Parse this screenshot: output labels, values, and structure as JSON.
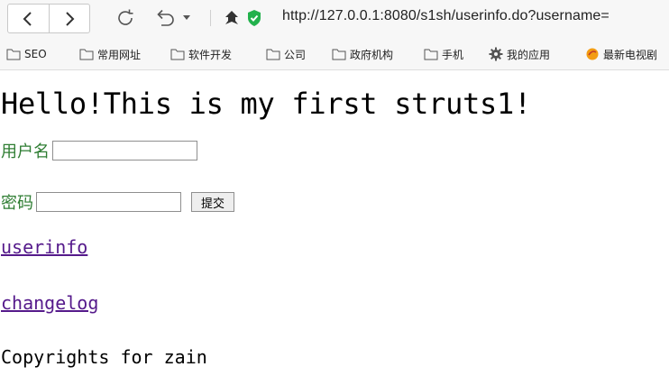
{
  "browser": {
    "url": "http://127.0.0.1:8080/s1sh/userinfo.do?username=",
    "icons": {
      "back": "chevron-left-icon",
      "forward": "chevron-right-icon",
      "refresh": "refresh-icon",
      "undo": "undo-icon",
      "undo_menu": "caret-down-icon",
      "security_a": "shield-icon",
      "security_b": "verified-shield-icon"
    },
    "colors": {
      "verified": "#22b14c",
      "folder_outline": "#555555"
    }
  },
  "bookmarks": [
    {
      "label": "SEO",
      "icon": "folder-icon"
    },
    {
      "label": "常用网址",
      "icon": "folder-icon"
    },
    {
      "label": "软件开发",
      "icon": "folder-icon"
    },
    {
      "label": "公司",
      "icon": "folder-icon"
    },
    {
      "label": "政府机构",
      "icon": "folder-icon"
    },
    {
      "label": "手机",
      "icon": "folder-icon"
    },
    {
      "label": "我的应用",
      "icon": "gear-icon"
    },
    {
      "label": "最新电视剧",
      "icon": "orange-circle-icon"
    }
  ],
  "page": {
    "headline": "Hello!This is my first struts1!",
    "form": {
      "username_label": "用户名",
      "username_value": "",
      "password_label": "密码",
      "password_value": "",
      "submit_label": "提交"
    },
    "links": {
      "userinfo": "userinfo",
      "changelog": "changelog"
    },
    "footer": "Copyrights for zain",
    "colors": {
      "label": "#2e7d32",
      "link_visited": "#551a8b"
    }
  }
}
